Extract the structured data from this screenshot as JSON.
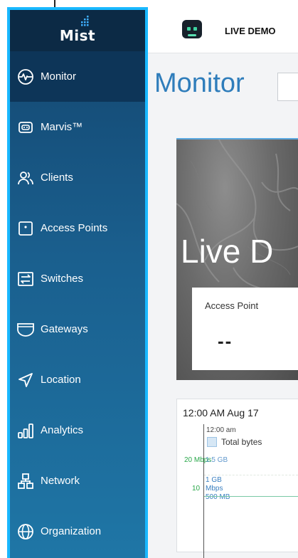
{
  "app": {
    "logo": "Mist",
    "org_name": "LIVE DEMO"
  },
  "sidebar": {
    "items": [
      {
        "label": "Monitor",
        "icon": "monitor-icon",
        "active": true
      },
      {
        "label": "Marvis™",
        "icon": "marvis-icon",
        "active": false
      },
      {
        "label": "Clients",
        "icon": "clients-icon",
        "active": false
      },
      {
        "label": "Access Points",
        "icon": "access-point-icon",
        "active": false
      },
      {
        "label": "Switches",
        "icon": "switch-icon",
        "active": false
      },
      {
        "label": "Gateways",
        "icon": "gateway-icon",
        "active": false
      },
      {
        "label": "Location",
        "icon": "location-icon",
        "active": false
      },
      {
        "label": "Analytics",
        "icon": "analytics-icon",
        "active": false
      },
      {
        "label": "Network",
        "icon": "network-icon",
        "active": false
      },
      {
        "label": "Organization",
        "icon": "organization-icon",
        "active": false
      }
    ]
  },
  "main": {
    "title": "Monitor",
    "map": {
      "overlay_text": "Live D",
      "stat": {
        "label": "Access Point",
        "value": "--"
      }
    },
    "chart": {
      "date": "12:00 AM Aug 17",
      "tooltip_time": "12:00 am",
      "legend_label": "Total bytes",
      "axis": {
        "mbps_20": "20 Mbps",
        "gb_15": "1.5 GB",
        "gb_1": "1 GB",
        "mbps_10_num": "10",
        "mbps_10_unit": "Mbps",
        "mb_500": "500 MB"
      }
    }
  },
  "colors": {
    "accent": "#2f7dbb",
    "highlight_border": "#19b8ff",
    "sidebar_active": "#0d3558"
  }
}
